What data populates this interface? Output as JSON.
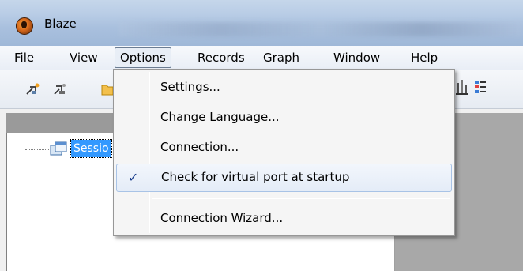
{
  "window": {
    "title": "Blaze"
  },
  "menubar": {
    "items": [
      {
        "label": "File"
      },
      {
        "label": "View"
      },
      {
        "label": "Options"
      },
      {
        "label": "Records"
      },
      {
        "label": "Graph"
      },
      {
        "label": "Window"
      },
      {
        "label": "Help"
      }
    ],
    "open_menu": "Options"
  },
  "options_menu": {
    "items": [
      {
        "label": "Settings...",
        "checked": false
      },
      {
        "label": "Change Language...",
        "checked": false
      },
      {
        "label": "Connection...",
        "checked": false
      },
      {
        "label": "Check for virtual port at startup",
        "checked": true
      },
      {
        "label": "Connection Wizard...",
        "checked": false
      }
    ],
    "check_glyph": "✓"
  },
  "tree": {
    "selected_node_label": "Sessio"
  },
  "colors": {
    "selection": "#3399ff",
    "check": "#1a3e8c"
  }
}
